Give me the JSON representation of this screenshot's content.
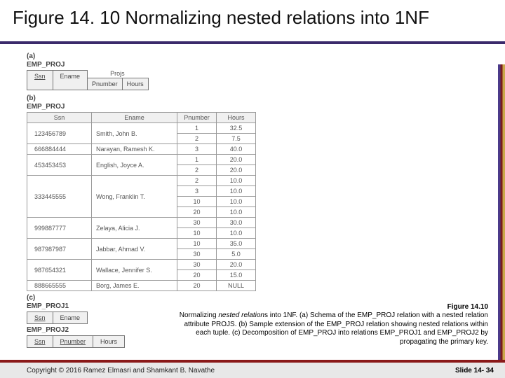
{
  "title": "Figure 14. 10 Normalizing nested relations into 1NF",
  "section_a": {
    "label": "(a)",
    "rel": "EMP_PROJ",
    "projs_label": "Projs",
    "cols": {
      "ssn": "Ssn",
      "ename": "Ename",
      "pnumber": "Pnumber",
      "hours": "Hours"
    }
  },
  "section_b": {
    "label": "(b)",
    "rel": "EMP_PROJ",
    "headers": {
      "ssn": "Ssn",
      "ename": "Ename",
      "pnumber": "Pnumber",
      "hours": "Hours"
    },
    "rows": [
      {
        "ssn": "123456789",
        "ename": "Smith, John B.",
        "sub": [
          {
            "pn": "1",
            "hrs": "32.5"
          },
          {
            "pn": "2",
            "hrs": "7.5"
          }
        ]
      },
      {
        "ssn": "666884444",
        "ename": "Narayan, Ramesh K.",
        "sub": [
          {
            "pn": "3",
            "hrs": "40.0"
          }
        ]
      },
      {
        "ssn": "453453453",
        "ename": "English, Joyce A.",
        "sub": [
          {
            "pn": "1",
            "hrs": "20.0"
          },
          {
            "pn": "2",
            "hrs": "20.0"
          }
        ]
      },
      {
        "ssn": "333445555",
        "ename": "Wong, Franklin T.",
        "sub": [
          {
            "pn": "2",
            "hrs": "10.0"
          },
          {
            "pn": "3",
            "hrs": "10.0"
          },
          {
            "pn": "10",
            "hrs": "10.0"
          },
          {
            "pn": "20",
            "hrs": "10.0"
          }
        ]
      },
      {
        "ssn": "999887777",
        "ename": "Zelaya, Alicia J.",
        "sub": [
          {
            "pn": "30",
            "hrs": "30.0"
          },
          {
            "pn": "10",
            "hrs": "10.0"
          }
        ]
      },
      {
        "ssn": "987987987",
        "ename": "Jabbar, Ahmad V.",
        "sub": [
          {
            "pn": "10",
            "hrs": "35.0"
          },
          {
            "pn": "30",
            "hrs": "5.0"
          }
        ]
      },
      {
        "ssn": "987654321",
        "ename": "Wallace, Jennifer S.",
        "sub": [
          {
            "pn": "30",
            "hrs": "20.0"
          },
          {
            "pn": "20",
            "hrs": "15.0"
          }
        ]
      },
      {
        "ssn": "888665555",
        "ename": "Borg, James E.",
        "sub": [
          {
            "pn": "20",
            "hrs": "NULL"
          }
        ]
      }
    ]
  },
  "section_c": {
    "label": "(c)",
    "rel1": "EMP_PROJ1",
    "rel2": "EMP_PROJ2",
    "cols1": {
      "ssn": "Ssn",
      "ename": "Ename"
    },
    "cols2": {
      "ssn": "Ssn",
      "pnumber": "Pnumber",
      "hours": "Hours"
    }
  },
  "caption": {
    "figref": "Figure 14.10",
    "text": "Normalizing nested relations into 1NF. (a) Schema of the EMP_PROJ relation with a nested relation attribute PROJS. (b) Sample extension of the EMP_PROJ relation showing nested relations within each tuple. (c) Decomposition of EMP_PROJ into relations EMP_PROJ1 and EMP_PROJ2 by propagating the primary key.",
    "italic": "nested relation"
  },
  "footer": {
    "copy": "Copyright © 2016 Ramez Elmasri and Shamkant B. Navathe",
    "slide": "Slide 14- 34"
  }
}
